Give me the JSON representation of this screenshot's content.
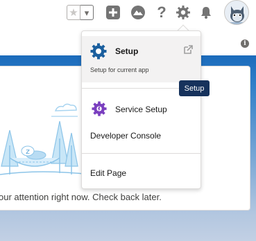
{
  "header": {
    "favorites_star": "★",
    "favorites_caret": "▾",
    "icons": [
      "add-icon",
      "trailhead-icon",
      "help-icon",
      "setup-gear-icon",
      "notifications-bell-icon"
    ],
    "help_glyph": "?"
  },
  "setup_menu": {
    "setup": {
      "title": "Setup",
      "subtitle": "Setup for current app"
    },
    "service_setup": "Service Setup",
    "developer_console": "Developer Console",
    "edit_page": "Edit Page"
  },
  "tooltip": {
    "text": "Setup"
  },
  "page": {
    "info_glyph": "i",
    "empty_message": "our attention right now. Check back later."
  },
  "colors": {
    "setup_gear": "#1b5f9e",
    "service_gear": "#7a3fbf",
    "tooltip_bg": "#16325c",
    "band_top": "#1b6bbb",
    "illustration": "#a8d4f0"
  }
}
